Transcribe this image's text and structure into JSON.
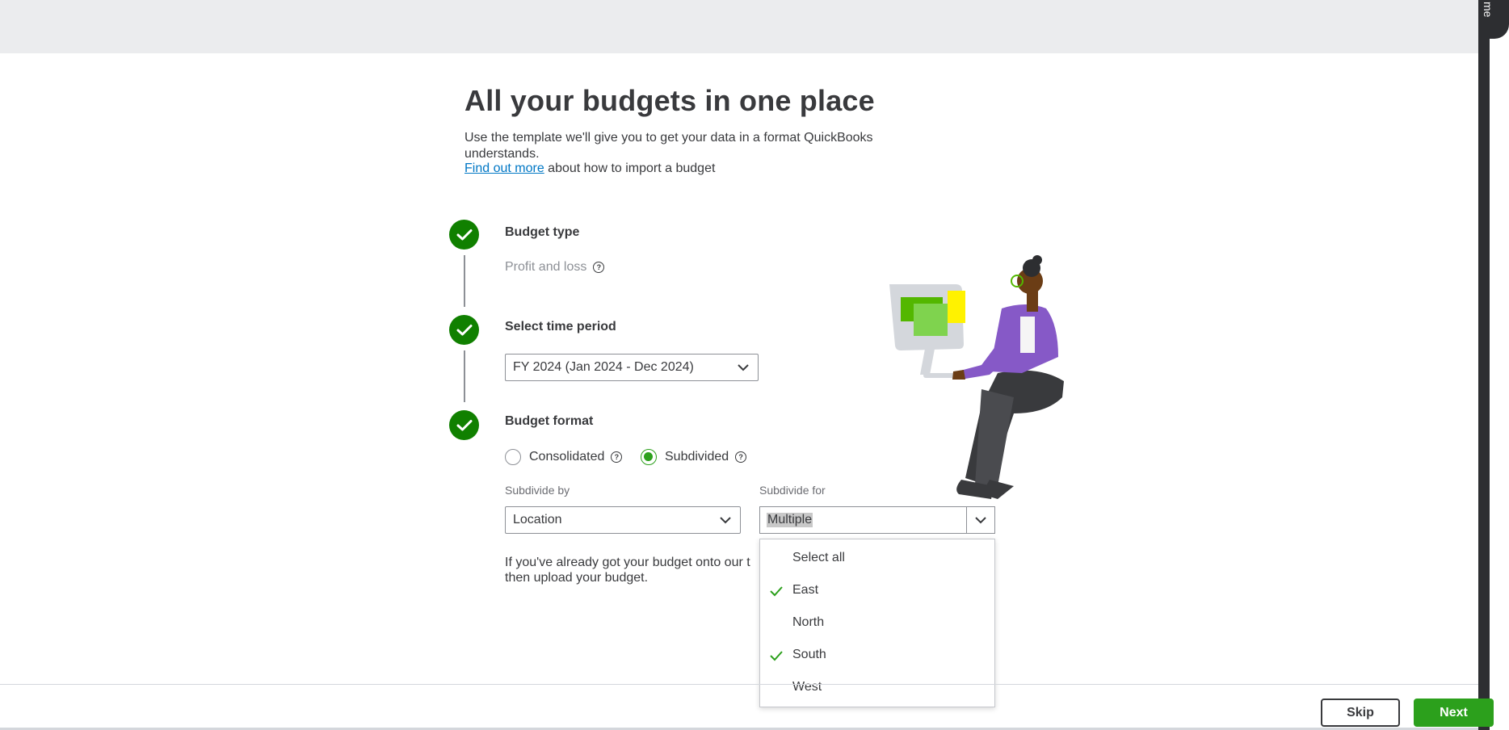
{
  "side_tab": {
    "label": "me"
  },
  "header": {
    "title": "All your budgets in one place",
    "intro": "Use the template we'll give you to get your data in a format QuickBooks understands.",
    "link_text": "Find out more",
    "link_suffix": " about how to import a budget"
  },
  "steps": {
    "budget_type": {
      "title": "Budget type",
      "value": "Profit and loss"
    },
    "time_period": {
      "title": "Select time period",
      "selected": "FY 2024 (Jan 2024 - Dec 2024)"
    },
    "budget_format": {
      "title": "Budget format",
      "option_consolidated": "Consolidated",
      "option_subdivided": "Subdivided",
      "selected": "Subdivided",
      "subdivide_by_label": "Subdivide by",
      "subdivide_by_value": "Location",
      "subdivide_for_label": "Subdivide for",
      "subdivide_for_value": "Multiple",
      "description": "If you've already got your budget onto our t then upload your budget."
    }
  },
  "dropdown": {
    "items": [
      {
        "label": "Select all",
        "checked": false
      },
      {
        "label": "East",
        "checked": true
      },
      {
        "label": "North",
        "checked": false
      },
      {
        "label": "South",
        "checked": true
      },
      {
        "label": "West",
        "checked": false
      }
    ]
  },
  "footer": {
    "skip_label": "Skip",
    "next_label": "Next"
  },
  "colors": {
    "primary_green": "#2ca01c",
    "step_green": "#108000",
    "link_blue": "#0077c5",
    "text": "#393a3d"
  }
}
